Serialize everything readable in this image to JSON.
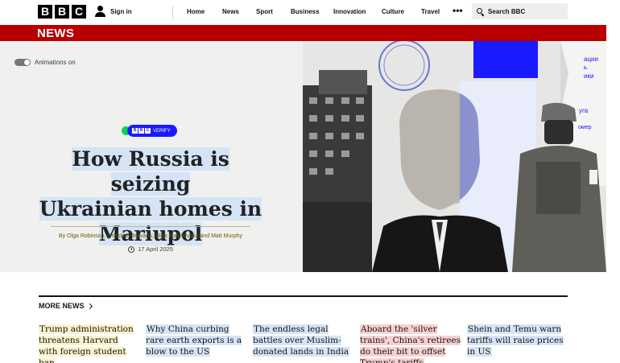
{
  "brand": {
    "letters": [
      "B",
      "B",
      "C"
    ]
  },
  "header": {
    "signin_label": "Sign in",
    "nav": [
      "Home",
      "News",
      "Sport",
      "Business",
      "Innovation",
      "Culture",
      "Travel"
    ],
    "more_label": "•••",
    "search_label": "Search BBC"
  },
  "section": {
    "title": "NEWS",
    "color": "#b80000"
  },
  "hero": {
    "animations_label": "Animations on",
    "badge": {
      "brand": [
        "B",
        "B",
        "C"
      ],
      "label": "VERIFY"
    },
    "headline": [
      "How Russia is seizing",
      "Ukrainian homes in",
      "Mariupol"
    ],
    "byline": "By Olga Robinson, Christine Jeavans, Olga Malchevska and Matt Murphy",
    "date": "17 April 2025",
    "image_text": [
      "ации",
      "ь",
      "ики",
      "уга",
      "омер"
    ]
  },
  "more_news": {
    "title": "MORE NEWS",
    "stories": [
      {
        "title": "Trump administration threatens Harvard with foreign student ban",
        "highlight": "#faf3cf"
      },
      {
        "title": "Why China curbing rare earth exports is a blow to the US",
        "highlight": "#d6e4f5"
      },
      {
        "title": "The endless legal battles over Muslim-donated lands in India",
        "highlight": "#d6e4f5"
      },
      {
        "title": "Aboard the 'silver trains', China's retirees do their bit to offset Trump's tariffs",
        "highlight": "#f7d1d1"
      },
      {
        "title": "Shein and Temu warn tariffs will raise prices in US",
        "highlight": "#d6e4f5"
      }
    ]
  }
}
